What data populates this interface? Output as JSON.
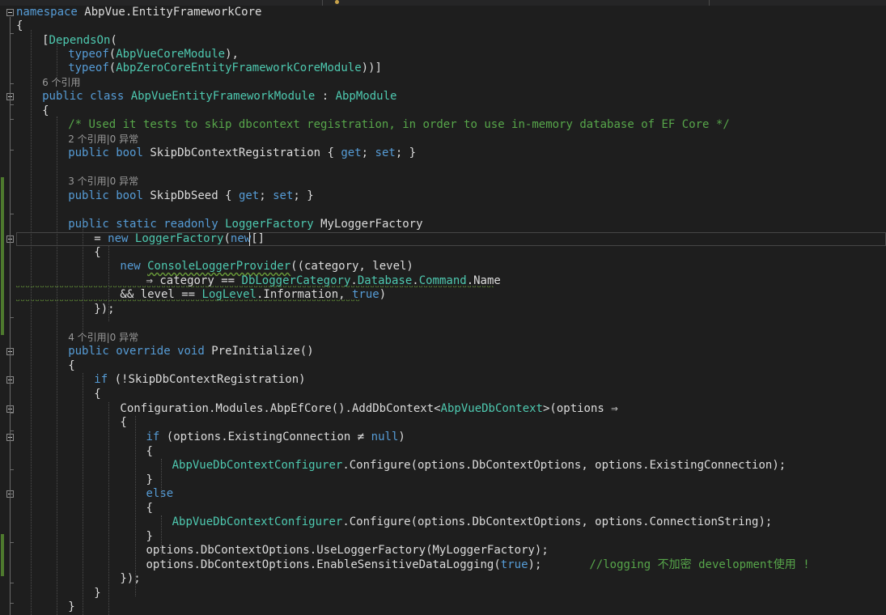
{
  "editor": {
    "lines": [
      {
        "indent": 0,
        "text": "namespace AbpVue.EntityFrameworkCore",
        "tokens": [
          [
            "namespace",
            "kw"
          ],
          [
            " AbpVue.EntityFrameworkCore",
            ""
          ]
        ]
      },
      {
        "indent": 0,
        "text": "{",
        "tokens": [
          [
            "{",
            ""
          ]
        ]
      },
      {
        "indent": 1,
        "text": "[DependsOn(",
        "tokens": [
          [
            "[",
            ""
          ],
          [
            "DependsOn",
            "ty"
          ],
          [
            "(",
            ""
          ]
        ]
      },
      {
        "indent": 2,
        "text": "typeof(AbpVueCoreModule),",
        "tokens": [
          [
            "typeof",
            "kw"
          ],
          [
            "(",
            ""
          ],
          [
            "AbpVueCoreModule",
            "ty"
          ],
          [
            "),",
            ""
          ]
        ]
      },
      {
        "indent": 2,
        "text": "typeof(AbpZeroCoreEntityFrameworkCoreModule))]",
        "tokens": [
          [
            "typeof",
            "kw"
          ],
          [
            "(",
            ""
          ],
          [
            "AbpZeroCoreEntityFrameworkCoreModule",
            "ty"
          ],
          [
            "))]",
            ""
          ]
        ]
      },
      {
        "indent": 1,
        "lens": "6 个引用"
      },
      {
        "indent": 1,
        "text": "public class AbpVueEntityFrameworkModule : AbpModule",
        "tokens": [
          [
            "public",
            "kw"
          ],
          [
            " ",
            ""
          ],
          [
            "class",
            "kw"
          ],
          [
            " ",
            ""
          ],
          [
            "AbpVueEntityFrameworkModule",
            "ty"
          ],
          [
            " : ",
            ""
          ],
          [
            "AbpModule",
            "ty"
          ]
        ]
      },
      {
        "indent": 1,
        "text": "{",
        "tokens": [
          [
            "{",
            ""
          ]
        ]
      },
      {
        "indent": 2,
        "text": "/* Used it tests to skip dbcontext registration, in order to use in-memory database of EF Core */",
        "tokens": [
          [
            "/* Used it tests to skip dbcontext registration, in order to use in-memory database of EF Core */",
            "cm"
          ]
        ]
      },
      {
        "indent": 2,
        "lens": "2 个引用|0 异常"
      },
      {
        "indent": 2,
        "text": "public bool SkipDbContextRegistration { get; set; }",
        "tokens": [
          [
            "public",
            "kw"
          ],
          [
            " ",
            ""
          ],
          [
            "bool",
            "kw"
          ],
          [
            " SkipDbContextRegistration { ",
            ""
          ],
          [
            "get",
            "kw"
          ],
          [
            "; ",
            ""
          ],
          [
            "set",
            "kw"
          ],
          [
            "; }",
            ""
          ]
        ]
      },
      {
        "indent": 0,
        "text": "",
        "tokens": []
      },
      {
        "indent": 2,
        "lens": "3 个引用|0 异常"
      },
      {
        "indent": 2,
        "text": "public bool SkipDbSeed { get; set; }",
        "tokens": [
          [
            "public",
            "kw"
          ],
          [
            " ",
            ""
          ],
          [
            "bool",
            "kw"
          ],
          [
            " SkipDbSeed { ",
            ""
          ],
          [
            "get",
            "kw"
          ],
          [
            "; ",
            ""
          ],
          [
            "set",
            "kw"
          ],
          [
            "; }",
            ""
          ]
        ]
      },
      {
        "indent": 0,
        "text": "",
        "tokens": []
      },
      {
        "indent": 2,
        "text": "public static readonly LoggerFactory MyLoggerFactory",
        "tokens": [
          [
            "public",
            "kw"
          ],
          [
            " ",
            ""
          ],
          [
            "static",
            "kw"
          ],
          [
            " ",
            ""
          ],
          [
            "readonly",
            "kw"
          ],
          [
            " ",
            ""
          ],
          [
            "LoggerFactory",
            "ty"
          ],
          [
            " MyLoggerFactory",
            ""
          ]
        ]
      },
      {
        "indent": 3,
        "text": "= new LoggerFactory(new[]",
        "tokens": [
          [
            "= ",
            ""
          ],
          [
            "new",
            "kw"
          ],
          [
            " ",
            ""
          ],
          [
            "LoggerFactory",
            "ty"
          ],
          [
            "(",
            ""
          ],
          [
            "new",
            "kw"
          ],
          [
            "[]",
            ""
          ]
        ]
      },
      {
        "indent": 3,
        "text": "{",
        "tokens": [
          [
            "{",
            ""
          ]
        ]
      },
      {
        "indent": 4,
        "text": "new ConsoleLoggerProvider((category, level)",
        "tokens": [
          [
            "new",
            "kw"
          ],
          [
            " ",
            ""
          ],
          [
            "ConsoleLoggerProvider",
            "ty sq"
          ],
          [
            "((category, level)",
            ""
          ]
        ]
      },
      {
        "indent": 5,
        "text": "⇒ category == DbLoggerCategory.Database.Command.Name",
        "tokens": [
          [
            "⇒ category == ",
            ""
          ],
          [
            "DbLoggerCategory",
            "ty"
          ],
          [
            ".",
            ""
          ],
          [
            "Database",
            "ty"
          ],
          [
            ".",
            ""
          ],
          [
            "Command",
            "ty"
          ],
          [
            ".Name",
            ""
          ]
        ]
      },
      {
        "indent": 4,
        "text": "&& level == LogLevel.Information, true)",
        "tokens": [
          [
            "&& level == ",
            ""
          ],
          [
            "LogLevel",
            "ty"
          ],
          [
            ".Information, ",
            ""
          ],
          [
            "true",
            "kw"
          ],
          [
            ")",
            ""
          ]
        ]
      },
      {
        "indent": 3,
        "text": "});",
        "tokens": [
          [
            "});",
            ""
          ]
        ]
      },
      {
        "indent": 0,
        "text": "",
        "tokens": []
      },
      {
        "indent": 2,
        "lens": "4 个引用|0 异常"
      },
      {
        "indent": 2,
        "text": "public override void PreInitialize()",
        "tokens": [
          [
            "public",
            "kw"
          ],
          [
            " ",
            ""
          ],
          [
            "override",
            "kw"
          ],
          [
            " ",
            ""
          ],
          [
            "void",
            "kw"
          ],
          [
            " PreInitialize()",
            ""
          ]
        ]
      },
      {
        "indent": 2,
        "text": "{",
        "tokens": [
          [
            "{",
            ""
          ]
        ]
      },
      {
        "indent": 3,
        "text": "if (!SkipDbContextRegistration)",
        "tokens": [
          [
            "if",
            "kw"
          ],
          [
            " (!SkipDbContextRegistration)",
            ""
          ]
        ]
      },
      {
        "indent": 3,
        "text": "{",
        "tokens": [
          [
            "{",
            ""
          ]
        ]
      },
      {
        "indent": 4,
        "text": "Configuration.Modules.AbpEfCore().AddDbContext<AbpVueDbContext>(options ⇒",
        "tokens": [
          [
            "Configuration.Modules.AbpEfCore().AddDbContext<",
            ""
          ],
          [
            "AbpVueDbContext",
            "ty"
          ],
          [
            ">(options ⇒",
            ""
          ]
        ]
      },
      {
        "indent": 4,
        "text": "{",
        "tokens": [
          [
            "{",
            ""
          ]
        ]
      },
      {
        "indent": 5,
        "text": "if (options.ExistingConnection ≠ null)",
        "tokens": [
          [
            "if",
            "kw"
          ],
          [
            " (options.ExistingConnection ≠ ",
            ""
          ],
          [
            "null",
            "kw"
          ],
          [
            ")",
            ""
          ]
        ]
      },
      {
        "indent": 5,
        "text": "{",
        "tokens": [
          [
            "{",
            ""
          ]
        ]
      },
      {
        "indent": 6,
        "text": "AbpVueDbContextConfigurer.Configure(options.DbContextOptions, options.ExistingConnection);",
        "tokens": [
          [
            "AbpVueDbContextConfigurer",
            "ty"
          ],
          [
            ".Configure(options.DbContextOptions, options.ExistingConnection);",
            ""
          ]
        ]
      },
      {
        "indent": 5,
        "text": "}",
        "tokens": [
          [
            "}",
            ""
          ]
        ]
      },
      {
        "indent": 5,
        "text": "else",
        "tokens": [
          [
            "else",
            "kw"
          ]
        ]
      },
      {
        "indent": 5,
        "text": "{",
        "tokens": [
          [
            "{",
            ""
          ]
        ]
      },
      {
        "indent": 6,
        "text": "AbpVueDbContextConfigurer.Configure(options.DbContextOptions, options.ConnectionString);",
        "tokens": [
          [
            "AbpVueDbContextConfigurer",
            "ty"
          ],
          [
            ".Configure(options.DbContextOptions, options.ConnectionString);",
            ""
          ]
        ]
      },
      {
        "indent": 5,
        "text": "}",
        "tokens": [
          [
            "}",
            ""
          ]
        ]
      },
      {
        "indent": 5,
        "text": "options.DbContextOptions.UseLoggerFactory(MyLoggerFactory);",
        "tokens": [
          [
            "options.DbContextOptions.UseLoggerFactory(MyLoggerFactory);",
            ""
          ]
        ]
      },
      {
        "indent": 5,
        "text": "options.DbContextOptions.EnableSensitiveDataLogging(true);       //logging 不加密 development使用 !",
        "tokens": [
          [
            "options.DbContextOptions.EnableSensitiveDataLogging(",
            ""
          ],
          [
            "true",
            "kw"
          ],
          [
            ");       ",
            ""
          ],
          [
            "//logging 不加密 development使用 !",
            "cm"
          ]
        ]
      },
      {
        "indent": 4,
        "text": "});",
        "tokens": [
          [
            "});",
            ""
          ]
        ]
      },
      {
        "indent": 3,
        "text": "}",
        "tokens": [
          [
            "}",
            ""
          ]
        ]
      },
      {
        "indent": 2,
        "text": "}",
        "tokens": [
          [
            "}",
            ""
          ]
        ]
      }
    ]
  }
}
